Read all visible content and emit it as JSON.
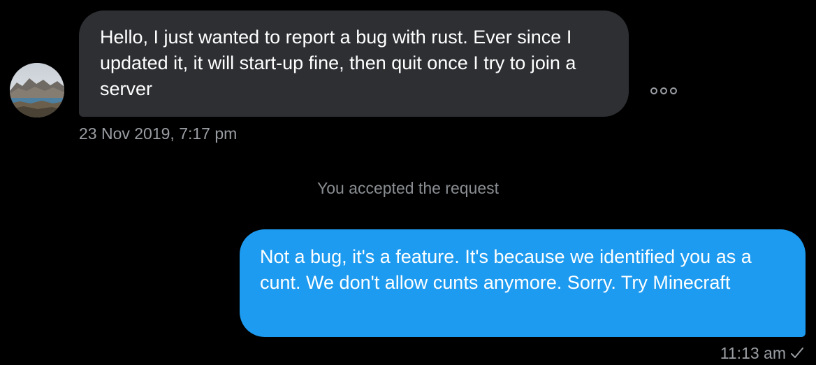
{
  "conversation": {
    "incoming": {
      "avatar_icon": "mountain-landscape-avatar",
      "text": "Hello, I just wanted to report a bug with rust.  Ever since I updated it, it will start-up fine, then quit once I try to join a server",
      "timestamp": "23 Nov 2019, 7:17 pm",
      "bubble_color": "#2d2f33",
      "more_icon": "more-options-icon"
    },
    "system_note": "You accepted the request",
    "outgoing": {
      "text": "Not a bug, it's a feature. It's because we identified you as a cunt. We don't allow cunts anymore. Sorry. Try Minecraft",
      "timestamp": "11:13 am",
      "status_icon": "check-icon",
      "bubble_color": "#1d9bf0"
    }
  },
  "colors": {
    "background": "#000000",
    "meta_text": "#9a9ea3"
  }
}
